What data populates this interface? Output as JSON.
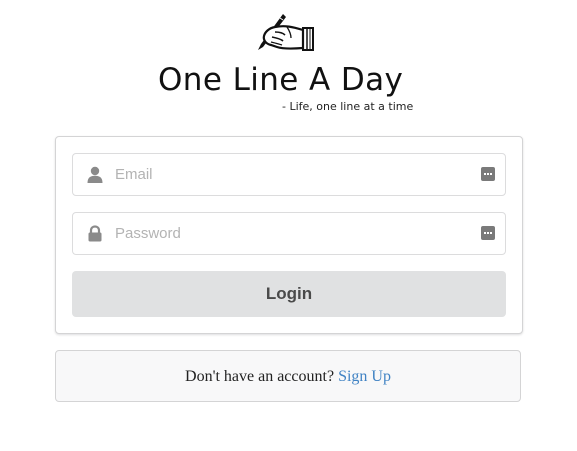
{
  "brand": {
    "title": "One Line A Day",
    "tagline": "- Life, one line at a time",
    "logo_icon": "hand-writing-with-pen-icon"
  },
  "login_form": {
    "email": {
      "placeholder": "Email",
      "value": "",
      "icon": "user-icon"
    },
    "password": {
      "placeholder": "Password",
      "value": "",
      "icon": "lock-icon"
    },
    "field_trailing_icon": "password-manager-icon",
    "submit_label": "Login"
  },
  "signup": {
    "prompt": "Don't have an account?",
    "link_label": "Sign Up"
  },
  "colors": {
    "link": "#4183c4",
    "button_bg": "#e0e1e2",
    "button_text": "#4a4a4a",
    "signup_bg": "#f8f8f9"
  }
}
